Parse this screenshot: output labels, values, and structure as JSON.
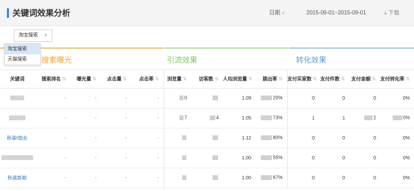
{
  "header": {
    "title": "关键词效果分析",
    "date_label": "日期",
    "date_range": "2015-09-01~2015-09-01",
    "download": "下载"
  },
  "filter": {
    "selected": "淘宝搜索",
    "options": [
      "淘宝搜索",
      "天猫搜索"
    ]
  },
  "groups": {
    "search": "搜索曝光",
    "traffic": "引流效果",
    "conversion": "转化效果"
  },
  "columns": [
    "关键词",
    "搜索排名",
    "曝光量",
    "点击量",
    "点击率",
    "浏览量",
    "访客数",
    "人均浏览量",
    "跳出率",
    "支付买家数",
    "支付件数",
    "支付金额",
    "支付转化率"
  ],
  "rows": [
    {
      "keyword": "",
      "rank": "-",
      "exposure": "-",
      "clicks": "-",
      "ctr": "-",
      "pv": "0",
      "uv": "",
      "avg_pv": "1.09",
      "bounce": "20%",
      "buyers": "0",
      "items": "0",
      "amount": "0",
      "conv": "0%"
    },
    {
      "keyword": "",
      "rank": "-",
      "exposure": "-",
      "clicks": "-",
      "ctr": "-",
      "pv": "7",
      "uv": "4",
      "avg_pv": "1.05",
      "bounce": "73%",
      "buyers": "1",
      "items": "1",
      "amount": "2",
      "conv": "0%"
    },
    {
      "keyword": "秋装t恤女",
      "rank": "-",
      "exposure": "-",
      "clicks": "-",
      "ctr": "-",
      "pv": "",
      "uv": "",
      "avg_pv": "1.12",
      "bounce": "80%",
      "buyers": "0",
      "items": "0",
      "amount": "0",
      "conv": "0%"
    },
    {
      "keyword": "",
      "rank": "-",
      "exposure": "-",
      "clicks": "-",
      "ctr": "-",
      "pv": "",
      "uv": "",
      "avg_pv": "1.00",
      "bounce": "55%",
      "buyers": "0",
      "items": "0",
      "amount": "0",
      "conv": "0%"
    },
    {
      "keyword": "秋装新款",
      "rank": "-",
      "exposure": "-",
      "clicks": "-",
      "ctr": "-",
      "pv": "",
      "uv": "",
      "avg_pv": "1.00",
      "bounce": "67%",
      "buyers": "0",
      "items": "0",
      "amount": "0",
      "conv": "0%"
    }
  ],
  "colors": {
    "accent": "#2e8ee0",
    "search_group": "#f0a33a",
    "traffic_group": "#7dc45c",
    "conversion_group": "#5a9ad4",
    "dropdown_selected_bg": "#d8e6f7"
  }
}
